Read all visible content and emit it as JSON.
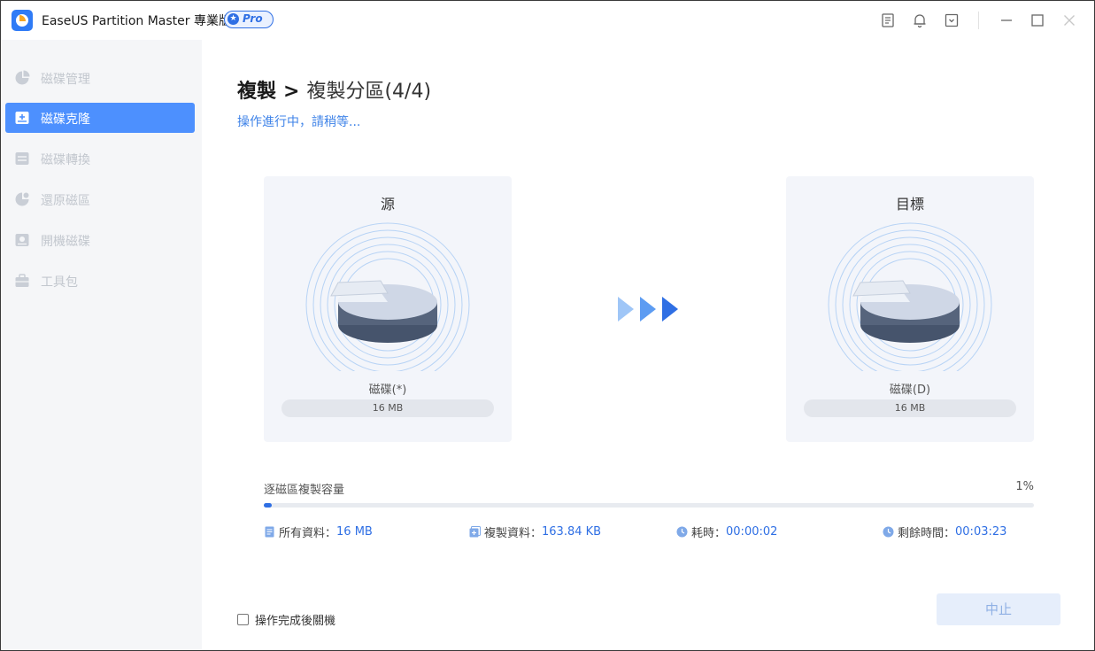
{
  "app": {
    "title": "EaseUS Partition Master 專業版",
    "badge": "Pro"
  },
  "sidebar": {
    "items": [
      {
        "label": "磁碟管理",
        "icon": "pie-chart-icon",
        "active": false
      },
      {
        "label": "磁碟克隆",
        "icon": "disk-clone-icon",
        "active": true
      },
      {
        "label": "磁碟轉換",
        "icon": "disk-convert-icon",
        "active": false
      },
      {
        "label": "還原磁區",
        "icon": "recover-partition-icon",
        "active": false
      },
      {
        "label": "開機磁碟",
        "icon": "bootable-disk-icon",
        "active": false
      },
      {
        "label": "工具包",
        "icon": "toolbox-icon",
        "active": false
      }
    ]
  },
  "main": {
    "breadcrumb_root": "複製",
    "breadcrumb_sep": ">",
    "breadcrumb_current": "複製分區(4/4)",
    "status": "操作進行中，請稍等...",
    "source": {
      "title": "源",
      "disk_name": "磁碟(*)",
      "size": "16 MB"
    },
    "target": {
      "title": "目標",
      "disk_name": "磁碟(D)",
      "size": "16 MB"
    },
    "progress": {
      "label": "逐磁區複製容量",
      "percent_text": "1%",
      "percent": 1
    },
    "stats": {
      "total_label": "所有資料：",
      "total_value": "16 MB",
      "copied_label": "複製資料：",
      "copied_value": "163.84 KB",
      "elapsed_label": "耗時：",
      "elapsed_value": "00:00:02",
      "remaining_label": "剩餘時間：",
      "remaining_value": "00:03:23"
    },
    "shutdown_label": "操作完成後關機",
    "abort_label": "中止"
  },
  "colors": {
    "accent": "#4d90fe",
    "link": "#3f83e8",
    "progress": "#2f6fe4"
  }
}
